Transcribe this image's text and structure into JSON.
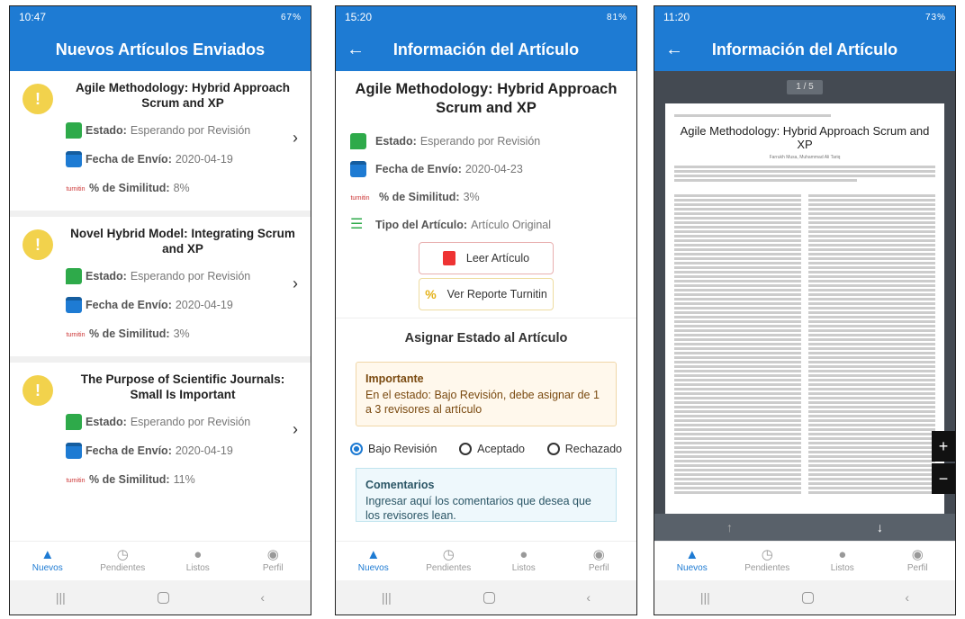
{
  "p1": {
    "time": "10:47",
    "sys": "67%",
    "title": "Nuevos Artículos Enviados",
    "articles": [
      {
        "title": "Agile Methodology: Hybrid Approach Scrum and XP",
        "estado_label": "Estado:",
        "estado": "Esperando por Revisión",
        "fecha_label": "Fecha de Envío:",
        "fecha": "2020-04-19",
        "sim_label": "% de Similitud:",
        "sim": "8%"
      },
      {
        "title": "Novel Hybrid Model: Integrating Scrum and XP",
        "estado_label": "Estado:",
        "estado": "Esperando por Revisión",
        "fecha_label": "Fecha de Envío:",
        "fecha": "2020-04-19",
        "sim_label": "% de Similitud:",
        "sim": "3%"
      },
      {
        "title": "The Purpose of Scientific Journals: Small Is Important",
        "estado_label": "Estado:",
        "estado": "Esperando por Revisión",
        "fecha_label": "Fecha de Envío:",
        "fecha": "2020-04-19",
        "sim_label": "% de Similitud:",
        "sim": "11%"
      }
    ]
  },
  "p2": {
    "time": "15:20",
    "sys": "81%",
    "title": "Información del Artículo",
    "article_title": "Agile Methodology: Hybrid Approach Scrum and XP",
    "estado_label": "Estado:",
    "estado": "Esperando por Revisión",
    "fecha_label": "Fecha de Envío:",
    "fecha": "2020-04-23",
    "sim_label": "% de Similitud:",
    "sim": "3%",
    "tipo_label": "Tipo del Artículo:",
    "tipo": "Artículo Original",
    "leer": "Leer Artículo",
    "reporte": "Ver Reporte Turnitin",
    "asignar": "Asignar Estado al Artículo",
    "alert_title": "Importante",
    "alert_text": "En el estado: Bajo Revisión, debe asignar de 1 a 3 revisores al artículo",
    "radios": [
      "Bajo Revisión",
      "Aceptado",
      "Rechazado"
    ],
    "coment_title": "Comentarios",
    "coment_text": "Ingresar aquí los comentarios que desea que los revisores lean."
  },
  "p3": {
    "time": "11:20",
    "sys": "73%",
    "title": "Información del Artículo",
    "pager": "1 / 5",
    "doc_title": "Agile Methodology: Hybrid Approach Scrum and XP",
    "authors": "Farrukh Musa, Muhammad Ali Tariq"
  },
  "nav": [
    "Nuevos",
    "Pendientes",
    "Listos",
    "Perfil"
  ],
  "turnitin": "turnitin"
}
